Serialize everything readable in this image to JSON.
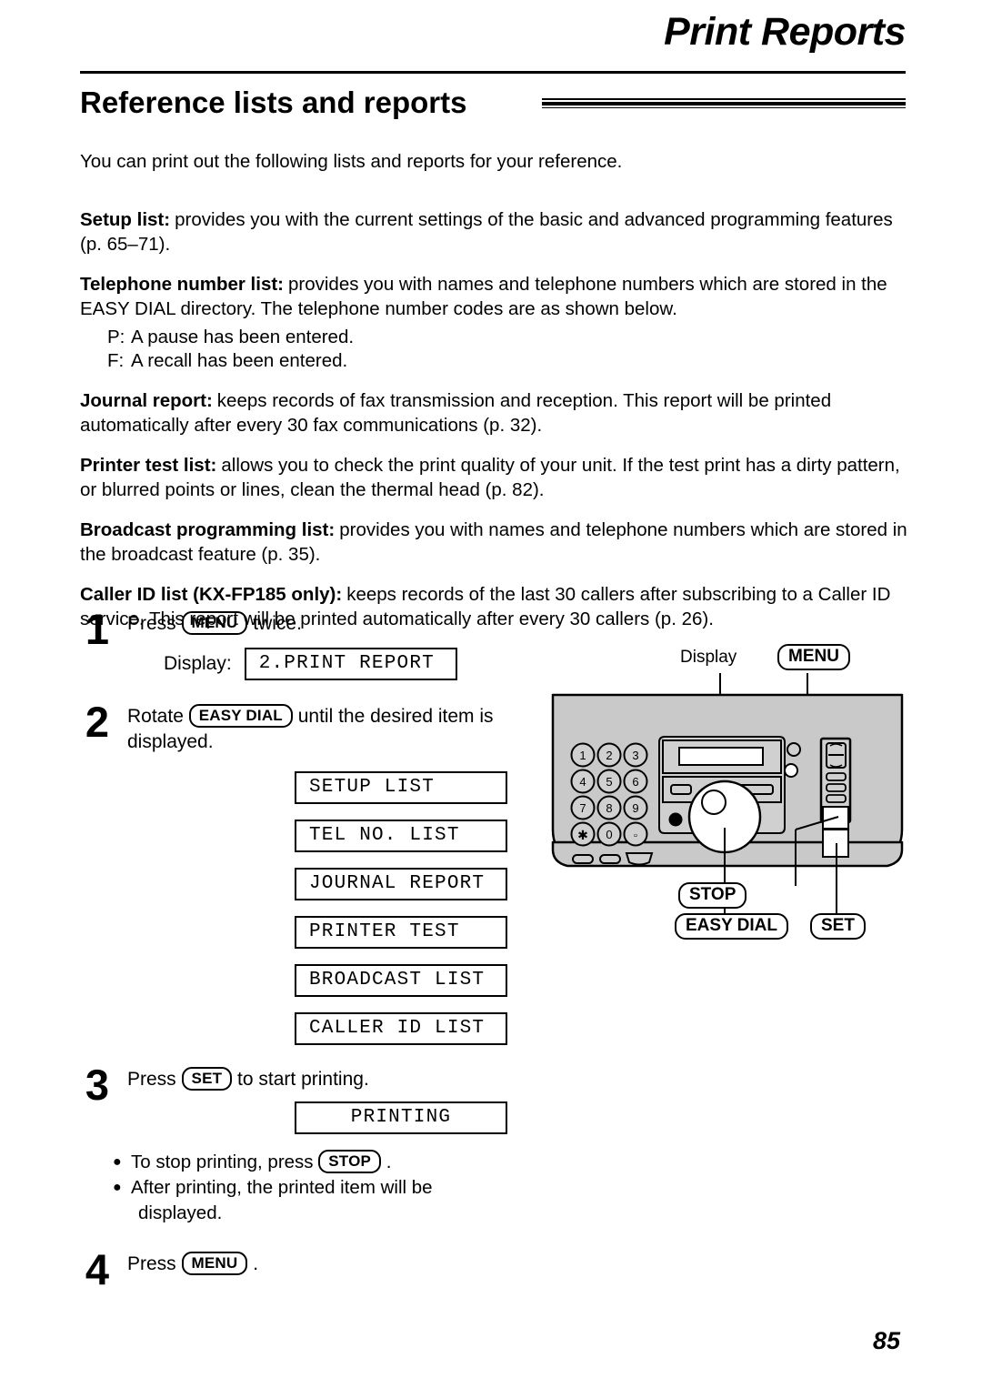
{
  "header": {
    "chapter_title": "Print Reports",
    "section_title": "Reference lists and reports"
  },
  "body": {
    "intro": "You can print out the following lists and reports for your reference.",
    "paragraphs": [
      {
        "term": "Setup list:",
        "text": "provides you with the current settings of the basic and advanced programming features (p. 65–71)."
      },
      {
        "term": "Telephone number list:",
        "text": "provides you with names and telephone numbers which are stored in the EASY DIAL directory. The telephone number codes are as shown below."
      },
      {
        "term": "Journal report:",
        "text": "keeps records of fax transmission and reception. This report will be printed automatically after every 30 fax communications (p. 32)."
      },
      {
        "term": "Printer test list:",
        "text": "allows you to check the print quality of your unit. If the test print has a dirty pattern, or blurred points or lines, clean the thermal head (p. 82)."
      },
      {
        "term": "Broadcast programming list:",
        "text": "provides you with names and telephone numbers which are stored in the broadcast feature (p. 35)."
      },
      {
        "term": "Caller ID list (KX-FP185 only):",
        "text": "keeps records of the last 30 callers after subscribing to a Caller ID service. This report will be printed automatically after every 30 callers (p. 26)."
      }
    ],
    "codes": [
      {
        "key": "P:",
        "meaning": "A pause has been entered."
      },
      {
        "key": "F:",
        "meaning": "A recall has been entered."
      }
    ]
  },
  "steps": {
    "step1": {
      "number": "1",
      "text_before": "Press",
      "key": "MENU",
      "text_after": "twice.",
      "display_label": "Display:",
      "display_value": "2.PRINT REPORT"
    },
    "step2": {
      "number": "2",
      "text_before": "Rotate",
      "key": "EASY DIAL",
      "text_after": "until the desired item is displayed.",
      "lcd_options": [
        "SETUP LIST",
        "TEL NO. LIST",
        "JOURNAL REPORT",
        "PRINTER TEST",
        "BROADCAST LIST",
        "CALLER ID LIST"
      ]
    },
    "step3": {
      "number": "3",
      "text_before": "Press",
      "key": "SET",
      "text_after": "to start printing.",
      "display_value": "PRINTING",
      "notes": [
        {
          "before": "To stop printing, press",
          "key": "STOP",
          "after": "."
        },
        {
          "before": "After printing, the printed item will be",
          "key": "",
          "after": "",
          "continuation": "displayed."
        }
      ]
    },
    "step4": {
      "number": "4",
      "text_before": "Press",
      "key": "MENU",
      "text_after": "."
    }
  },
  "figure": {
    "callouts": {
      "display": "Display",
      "menu": "MENU",
      "stop": "STOP",
      "easy_dial": "EASY DIAL",
      "set": "SET"
    },
    "keypad": [
      [
        "1",
        "2",
        "3"
      ],
      [
        "4",
        "5",
        "6"
      ],
      [
        "7",
        "8",
        "9"
      ],
      [
        "✳",
        "0",
        "□"
      ]
    ],
    "colors": {
      "body_fill": "#c9c9c9",
      "panel_fill": "#d0d0d0",
      "outline": "#000000",
      "lcd_fill": "#ffffff"
    }
  },
  "footer": {
    "page_number": "85"
  }
}
